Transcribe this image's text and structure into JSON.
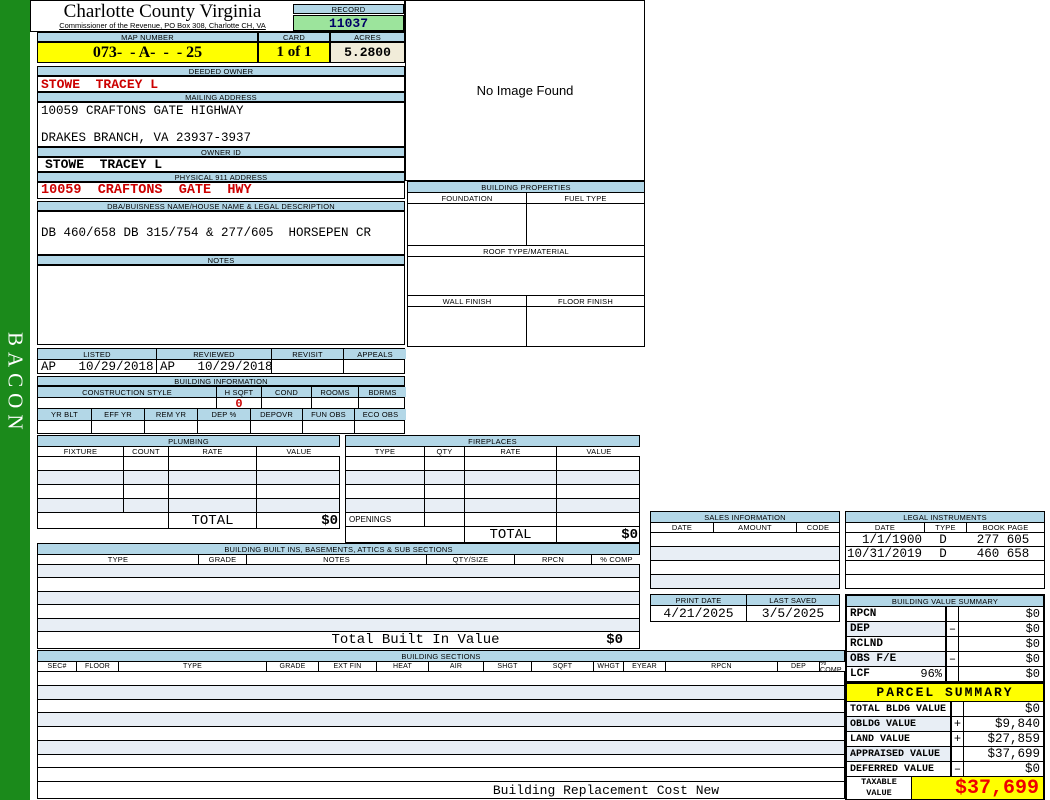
{
  "colors": {
    "sidebar_green": "#1b8a1b",
    "header_blue": "#b3d7e7",
    "row_alt_blue": "#e8eef5",
    "highlight_yellow": "#ffff00",
    "record_green": "#9ce49c",
    "acres_cream": "#f1ecd9",
    "owner_red": "#cc0000",
    "taxable_red": "#ee0000",
    "record_navy": "#000066"
  },
  "sidebar": {
    "vertical_text": "BACON"
  },
  "header": {
    "county": "Charlotte County Virginia",
    "subtitle": "Commissioner of the Revenue, PO Box 308, Charlotte CH, VA",
    "record_label": "RECORD",
    "record_value": "11037",
    "map_number_label": "MAP NUMBER",
    "map_number_value": "073-  - A-  -  - 25",
    "card_label": "CARD",
    "card_value": "1 of 1",
    "acres_label": "ACRES",
    "acres_value": "5.2800"
  },
  "owner": {
    "deeded_owner_label": "DEEDED OWNER",
    "deeded_owner": "STOWE  TRACEY L",
    "mailing_address_label": "MAILING ADDRESS",
    "mailing_line1": "10059 CRAFTONS GATE HIGHWAY",
    "mailing_line2": "DRAKES BRANCH, VA 23937-3937",
    "owner_id_label": "OWNER ID",
    "owner_id": "STOWE  TRACEY L",
    "physical_address_label": "PHYSICAL 911 ADDRESS",
    "physical_address": "10059  CRAFTONS  GATE  HWY",
    "dba_label": "DBA/BUISNESS NAME/HOUSE NAME & LEGAL DESCRIPTION",
    "legal_description": "DB 460/658 DB 315/754 & 277/605  HORSEPEN CR",
    "notes_label": "NOTES"
  },
  "review": {
    "listed_label": "LISTED",
    "reviewed_label": "REVIEWED",
    "revisit_label": "REVISIT",
    "appeals_label": "APPEALS",
    "listed": "AP   10/29/2018",
    "reviewed": "AP   10/29/2018"
  },
  "building_information": {
    "title": "BUILDING INFORMATION",
    "construction_style_label": "CONSTRUCTION STYLE",
    "h_sqft_label": "H SQFT",
    "cond_label": "COND",
    "rooms_label": "ROOMS",
    "bdrms_label": "BDRMS",
    "h_sqft_value": "0",
    "yr_blt_label": "YR BLT",
    "eff_yr_label": "EFF YR",
    "rem_yr_label": "REM YR",
    "dep_pct_label": "DEP %",
    "depovr_label": "DEPOVR",
    "fun_obs_label": "FUN OBS",
    "eco_obs_label": "ECO OBS"
  },
  "plumbing": {
    "title": "PLUMBING",
    "headers": [
      "FIXTURE",
      "COUNT",
      "RATE",
      "VALUE"
    ],
    "total_label": "TOTAL",
    "total_value": "$0"
  },
  "fireplaces": {
    "title": "FIREPLACES",
    "headers": [
      "TYPE",
      "QTY",
      "RATE",
      "VALUE"
    ],
    "openings_label": "OPENINGS",
    "total_label": "TOTAL",
    "total_value": "$0"
  },
  "built_ins": {
    "title": "BUILDING BUILT INS, BASEMENTS, ATTICS & SUB SECTIONS",
    "headers": [
      "TYPE",
      "GRADE",
      "NOTES",
      "QTY/SIZE",
      "RPCN",
      "% COMP"
    ],
    "total_label": "Total Built In Value",
    "total_value": "$0"
  },
  "building_sections": {
    "title": "BUILDING SECTIONS",
    "headers": [
      "SEC#",
      "FLOOR",
      "TYPE",
      "GRADE",
      "EXT FIN",
      "HEAT",
      "AIR",
      "SHGT",
      "SQFT",
      "WHGT",
      "EYEAR",
      "RPCN",
      "DEP",
      "% COMP"
    ],
    "footer": "Building Replacement Cost New"
  },
  "image_panel": {
    "message": "No Image Found"
  },
  "building_properties": {
    "title": "BUILDING PROPERTIES",
    "foundation_label": "FOUNDATION",
    "fuel_type_label": "FUEL TYPE",
    "roof_label": "ROOF TYPE/MATERIAL",
    "wall_finish_label": "WALL FINISH",
    "floor_finish_label": "FLOOR FINISH"
  },
  "sales_information": {
    "title": "SALES INFORMATION",
    "headers": [
      "DATE",
      "AMOUNT",
      "CODE"
    ]
  },
  "legal_instruments": {
    "title": "LEGAL INSTRUMENTS",
    "headers": [
      "DATE",
      "TYPE",
      "BOOK PAGE"
    ],
    "rows": [
      {
        "date": "1/1/1900",
        "type": "D",
        "book_page": "277 605"
      },
      {
        "date": "10/31/2019",
        "type": "D",
        "book_page": "460 658"
      }
    ]
  },
  "dates": {
    "print_date_label": "PRINT DATE",
    "print_date": "4/21/2025",
    "last_saved_label": "LAST SAVED",
    "last_saved": "3/5/2025"
  },
  "building_value_summary": {
    "title": "BUILDING VALUE SUMMARY",
    "rows": [
      {
        "label": "RPCN",
        "extra": "",
        "op": "",
        "value": "$0"
      },
      {
        "label": "DEP",
        "extra": "",
        "op": "–",
        "value": "$0"
      },
      {
        "label": "RCLND",
        "extra": "",
        "op": "",
        "value": "$0"
      },
      {
        "label": "OBS F/E",
        "extra": "",
        "op": "–",
        "value": "$0"
      },
      {
        "label": "LCF",
        "extra": "96%",
        "op": "",
        "value": "$0"
      }
    ]
  },
  "parcel_summary": {
    "title": "PARCEL SUMMARY",
    "rows": [
      {
        "label": "TOTAL BLDG VALUE",
        "op": "",
        "value": "$0"
      },
      {
        "label": "OBLDG VALUE",
        "op": "+",
        "value": "$9,840"
      },
      {
        "label": "LAND VALUE",
        "op": "+",
        "value": "$27,859"
      },
      {
        "label": "APPRAISED VALUE",
        "op": "",
        "value": "$37,699"
      },
      {
        "label": "DEFERRED VALUE",
        "op": "–",
        "value": "$0"
      }
    ],
    "taxable_label": "TAXABLE\nVALUE",
    "taxable_value": "$37,699"
  }
}
